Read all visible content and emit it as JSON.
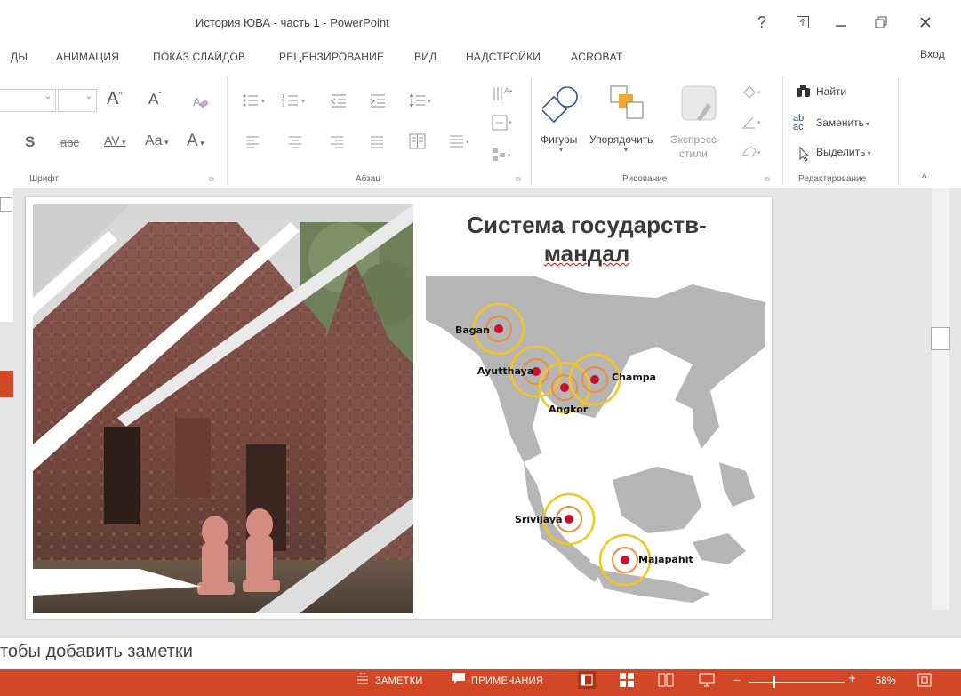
{
  "window": {
    "title": "История ЮВА - часть 1 - PowerPoint",
    "help": "?",
    "signin": "Вход"
  },
  "tabs": [
    "ДЫ",
    "АНИМАЦИЯ",
    "ПОКАЗ СЛАЙДОВ",
    "РЕЦЕНЗИРОВАНИЕ",
    "ВИД",
    "НАДСТРОЙКИ",
    "ACROBAT"
  ],
  "ribbon": {
    "groups": {
      "font": "Шрифт",
      "paragraph": "Абзац",
      "drawing": "Рисование",
      "editing": "Редактирование"
    },
    "drawing": {
      "shapes": "Фигуры",
      "arrange": "Упорядочить",
      "quick_styles_1": "Экспресс-",
      "quick_styles_2": "стили"
    },
    "editing": {
      "find": "Найти",
      "replace": "Заменить",
      "select": "Выделить"
    },
    "font_glyphs": {
      "bold_s": "S",
      "strike": "abc",
      "spacing": "AV",
      "case": "Aa",
      "color": "A",
      "grow": "A",
      "shrink": "A"
    }
  },
  "slide": {
    "title_line1": "Система государств-",
    "title_line2": "мандал",
    "map_labels": [
      "Bagan",
      "Ayutthaya",
      "Champa",
      "Angkor",
      "Srivijaya",
      "Majapahit"
    ]
  },
  "notes": {
    "placeholder": "тобы добавить заметки"
  },
  "status": {
    "notes": "ЗАМЕТКИ",
    "comments": "ПРИМЕЧАНИЯ",
    "zoom": "58%"
  },
  "colors": {
    "accent": "#d24726",
    "ring": "#f5c518",
    "dot": "#c8102e"
  }
}
